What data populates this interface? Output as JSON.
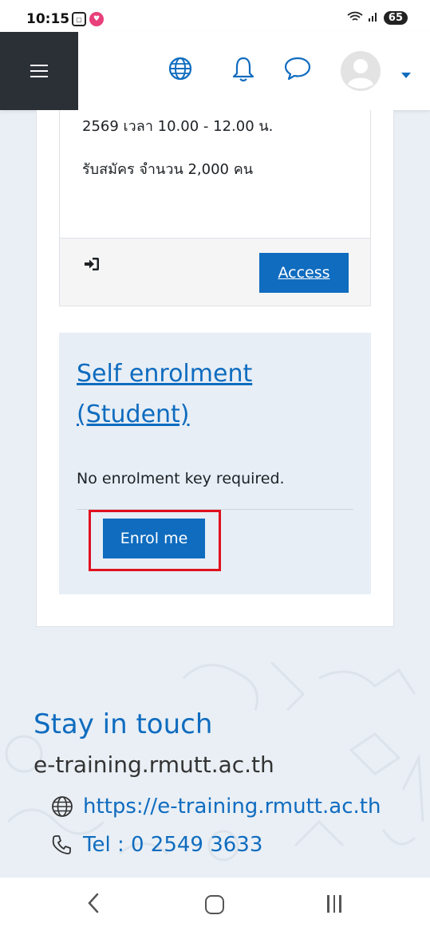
{
  "status_bar": {
    "time": "10:15",
    "battery": "65"
  },
  "navbar": {
    "icons": [
      "hamburger-icon",
      "globe-icon",
      "bell-icon",
      "chat-icon",
      "avatar",
      "chevron-down-icon"
    ]
  },
  "course": {
    "desc_line1": "2569 เวลา 10.00 - 12.00 น.",
    "desc_line2": "รับสมัคร จำนวน 2,000 คน",
    "access_label": "Access"
  },
  "enrolment": {
    "title": "Self enrolment (Student)",
    "note": "No enrolment key required.",
    "button_label": "Enrol me"
  },
  "footer": {
    "heading": "Stay in touch",
    "site_name": "e-training.rmutt.ac.th",
    "website": "https://e-training.rmutt.ac.th",
    "phone": "Tel : 0 2549 3633"
  },
  "colors": {
    "accent": "#0f6cbf",
    "highlight": "#e0101f",
    "nav_dark": "#2b2f36"
  }
}
